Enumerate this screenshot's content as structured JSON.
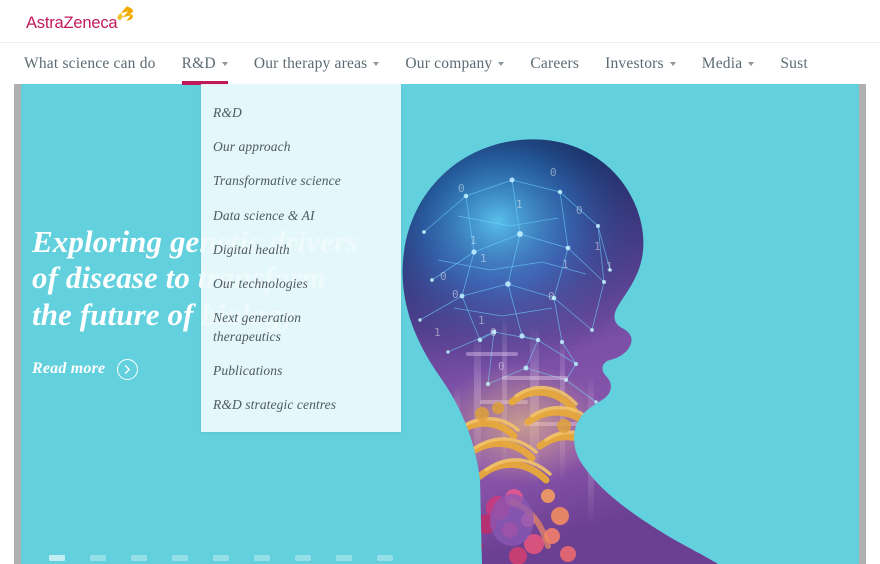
{
  "brand": {
    "logo_text": "AstraZeneca",
    "logo_mark_name": "astrazeneca-az-flame-mark",
    "logo_color": "#c2195b",
    "mark_color": "#f0ab00"
  },
  "nav": {
    "items": [
      {
        "label": "What science can do",
        "has_caret": false,
        "active": false
      },
      {
        "label": "R&D",
        "has_caret": true,
        "active": true
      },
      {
        "label": "Our therapy areas",
        "has_caret": true,
        "active": false
      },
      {
        "label": "Our company",
        "has_caret": true,
        "active": false
      },
      {
        "label": "Careers",
        "has_caret": false,
        "active": false
      },
      {
        "label": "Investors",
        "has_caret": true,
        "active": false
      },
      {
        "label": "Media",
        "has_caret": true,
        "active": false
      },
      {
        "label": "Sust",
        "has_caret": false,
        "active": false
      }
    ],
    "active_indicator_color": "#c2195b"
  },
  "dropdown": {
    "parent": "R&D",
    "background_color": "#eefafc",
    "items": [
      {
        "label": "R&D"
      },
      {
        "label": "Our approach"
      },
      {
        "label": "Transformative science"
      },
      {
        "label": "Data science & AI"
      },
      {
        "label": "Digital health"
      },
      {
        "label": "Our technologies"
      },
      {
        "label": "Next generation therapeutics"
      },
      {
        "label": "Publications"
      },
      {
        "label": "R&D strategic centres"
      }
    ]
  },
  "hero": {
    "background_color": "#62d0dd",
    "title_line_1": "Exploring genetic drivers",
    "title_line_2": "of disease to transform",
    "title_line_3": "the future of biology",
    "cta_label": "Read more",
    "cta_icon": "chevron-right-circle-icon",
    "artwork_name": "human-silhouette-neural-network-dna-artwork",
    "artwork_colors": {
      "brain_network": "#2fa8e8",
      "head_dark": "#1a2347",
      "torso_purple": "#7b4fa8",
      "dna_gold": "#e8a93c",
      "dna_pink": "#d4457f"
    },
    "carousel": {
      "count": 9,
      "active_index": 0
    }
  }
}
